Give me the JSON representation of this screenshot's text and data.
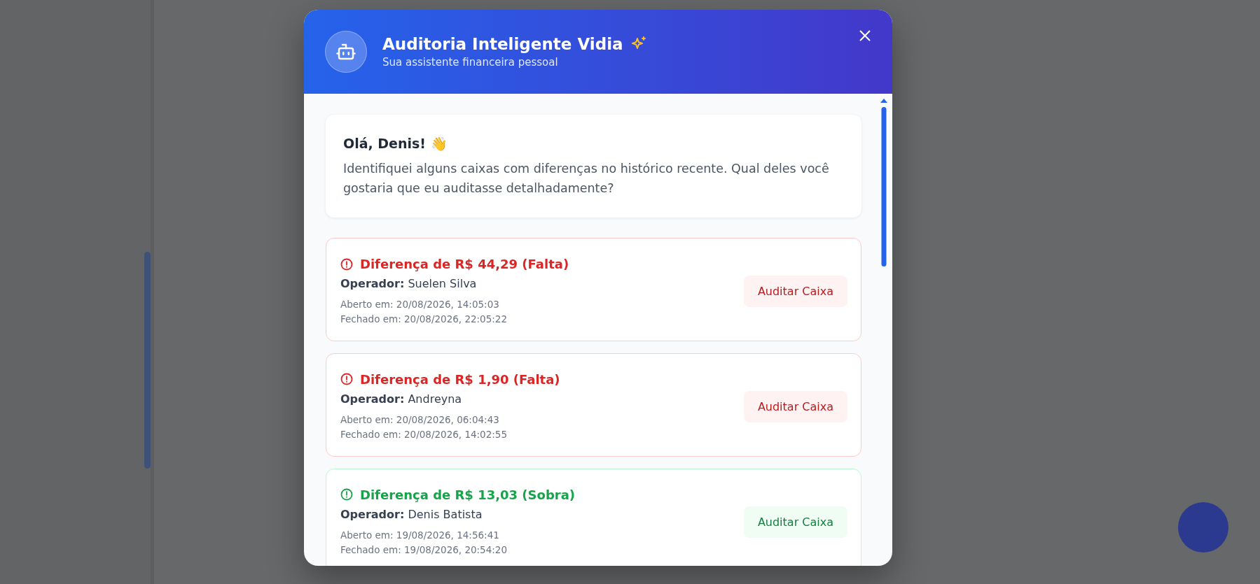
{
  "dialog": {
    "title": "Auditoria Inteligente Vidia",
    "subtitle": "Sua assistente financeira pessoal"
  },
  "greeting": {
    "title": "Olá, Denis! 👋",
    "message": "Identifiquei alguns caixas com diferenças no histórico recente. Qual deles você gostaria que eu auditasse detalhadamente?"
  },
  "cases": [
    {
      "kind": "falta",
      "title": "Diferença de R$ 44,29 (Falta)",
      "operator_label": "Operador:",
      "operator": "Suelen Silva",
      "opened": "Aberto em: 20/08/2026, 14:05:03",
      "closed": "Fechado em: 20/08/2026, 22:05:22",
      "button": "Auditar Caixa"
    },
    {
      "kind": "falta",
      "title": "Diferença de R$ 1,90 (Falta)",
      "operator_label": "Operador:",
      "operator": "Andreyna",
      "opened": "Aberto em: 20/08/2026, 06:04:43",
      "closed": "Fechado em: 20/08/2026, 14:02:55",
      "button": "Auditar Caixa"
    },
    {
      "kind": "sobra",
      "title": "Diferença de R$ 13,03 (Sobra)",
      "operator_label": "Operador:",
      "operator": "Denis Batista",
      "opened": "Aberto em: 19/08/2026, 14:56:41",
      "closed": "Fechado em: 19/08/2026, 20:54:20",
      "button": "Auditar Caixa"
    }
  ]
}
